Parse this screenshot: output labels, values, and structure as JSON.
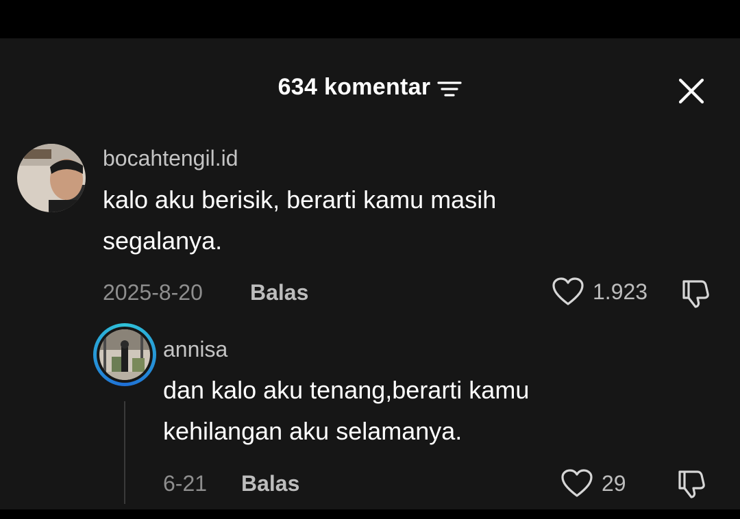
{
  "header": {
    "title": "634 komentar",
    "filter_icon": "sort-lines-icon",
    "close_icon": "close-x-icon"
  },
  "comments": [
    {
      "username": "bocahtengil.id",
      "text_line1": "kalo aku berisik, berarti kamu masih",
      "text_line2": "segalanya.",
      "date": "2025-8-20",
      "reply_label": "Balas",
      "likes": "1.923"
    }
  ],
  "replies": [
    {
      "username": "annisa",
      "text_line1": "dan kalo aku tenang,berarti kamu",
      "text_line2": "kehilangan aku selamanya.",
      "date": "6-21",
      "reply_label": "Balas",
      "likes": "29"
    }
  ],
  "colors": {
    "background": "#161616",
    "text_primary": "#ffffff",
    "text_secondary": "#c4c4c4",
    "text_muted": "#8e8e8e",
    "story_ring_start": "#2fc2d8",
    "story_ring_end": "#1f6fd6"
  }
}
